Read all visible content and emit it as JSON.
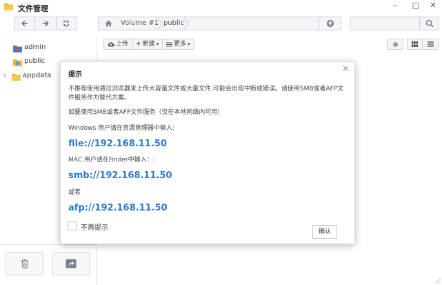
{
  "window": {
    "title": "文件管理",
    "icon": "folder-icon",
    "controls": {
      "minimize": "–",
      "maximize": "□",
      "close": "✕"
    }
  },
  "navigation": {
    "back_icon": "arrow-left-icon",
    "forward_icon": "arrow-right-icon",
    "refresh_icon": "refresh-icon"
  },
  "address": {
    "home_icon": "home-icon",
    "breadcrumbs": [
      "Volume #1",
      "public"
    ],
    "up_icon": "upload-arrow-icon"
  },
  "search": {
    "placeholder": "",
    "icon": "search-icon"
  },
  "sidebar": {
    "items": [
      {
        "label": "admin",
        "icon": "user-folder-icon"
      },
      {
        "label": "public",
        "icon": "public-folder-icon"
      },
      {
        "label": "appdata",
        "icon": "folder-icon",
        "expandable": true
      }
    ],
    "bottom_buttons": [
      {
        "name": "trash",
        "icon": "trash-icon"
      },
      {
        "name": "share",
        "icon": "share-icon"
      }
    ]
  },
  "actions": {
    "upload": "上传",
    "new": "新建",
    "more": "更多",
    "settings_icon": "gear-icon",
    "grid_icon": "grid-view-icon",
    "list_icon": "list-view-icon"
  },
  "dialog": {
    "title": "提示",
    "close": "×",
    "warning": "不推荐使用通过浏览器来上传大容量文件或大量文件,可能会出现中断或错误。请使用SMB或者AFP文件服务作为替代方案。",
    "smb_hint": "如要使用SMB或者AFP文件服务（仅在本地网络内可用）",
    "windows_hint": "Windows 用户请在资源管理器中输入:",
    "file_url": "file://192.168.11.50",
    "mac_hint": "MAC 用户请在Finder中输入：:",
    "smb_url": "smb://192.168.11.50",
    "or": "或者",
    "afp_url": "afp://192.168.11.50",
    "dont_show": "不再提示",
    "ok": "确认"
  },
  "colors": {
    "link_blue": "#2f7bd0",
    "folder_yellow": "#f2b532",
    "toolbar_bg": "#f3f5f8",
    "border": "#c9ced6"
  }
}
